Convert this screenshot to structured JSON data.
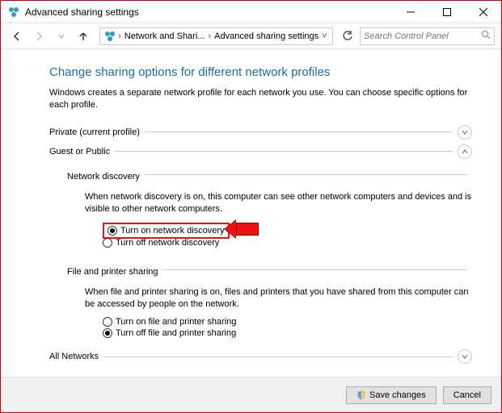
{
  "titlebar": {
    "title": "Advanced sharing settings"
  },
  "toolbar": {
    "breadcrumb": {
      "item1": "Network and Shari...",
      "item2": "Advanced sharing settings"
    },
    "search_placeholder": "Search Control Panel"
  },
  "page": {
    "heading": "Change sharing options for different network profiles",
    "description": "Windows creates a separate network profile for each network you use. You can choose specific options for each profile."
  },
  "sections": {
    "private": {
      "label": "Private (current profile)"
    },
    "guest": {
      "label": "Guest or Public",
      "network_discovery": {
        "title": "Network discovery",
        "desc": "When network discovery is on, this computer can see other network computers and devices and is visible to other network computers.",
        "opt_on": "Turn on network discovery",
        "opt_off": "Turn off network discovery"
      },
      "file_printer": {
        "title": "File and printer sharing",
        "desc": "When file and printer sharing is on, files and printers that you have shared from this computer can be accessed by people on the network.",
        "opt_on": "Turn on file and printer sharing",
        "opt_off": "Turn off file and printer sharing"
      }
    },
    "all": {
      "label": "All Networks"
    }
  },
  "footer": {
    "save": "Save changes",
    "cancel": "Cancel"
  }
}
